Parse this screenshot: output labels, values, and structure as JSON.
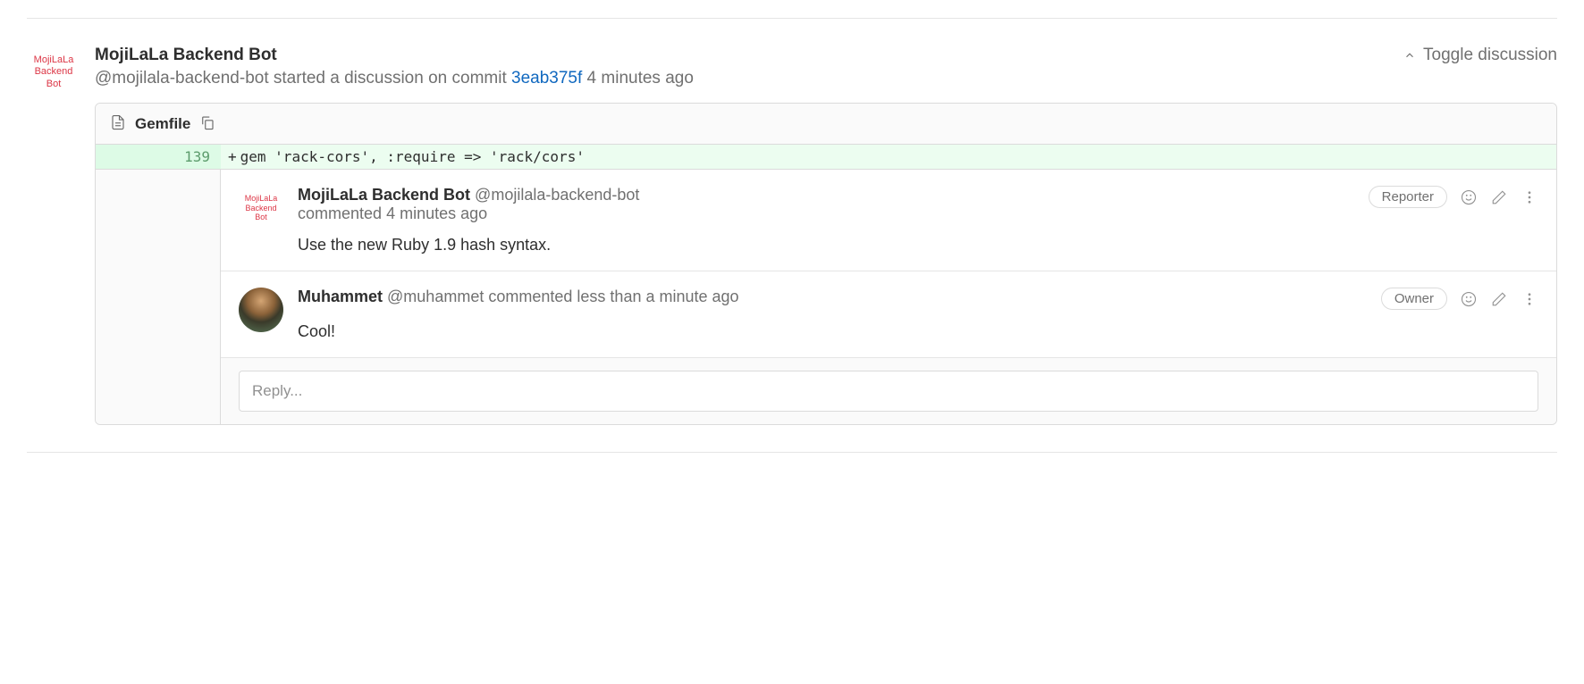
{
  "discussion": {
    "author_name": "MojiLaLa Backend Bot",
    "author_handle": "@mojilala-backend-bot",
    "action_text": "started a discussion on commit",
    "commit_sha": "3eab375f",
    "timestamp": "4 minutes ago",
    "avatar_text": "MojiLaLa\nBackend\nBot"
  },
  "toggle_label": "Toggle discussion",
  "file": {
    "name": "Gemfile"
  },
  "diff": {
    "line_number": "139",
    "prefix": "+",
    "code": "gem 'rack-cors', :require => 'rack/cors'"
  },
  "notes": [
    {
      "author_name": "MojiLaLa Backend Bot",
      "author_handle": "@mojilala-backend-bot",
      "action": "commented",
      "timestamp": "4 minutes ago",
      "role": "Reporter",
      "body": "Use the new Ruby 1.9 hash syntax.",
      "avatar_type": "text",
      "avatar_text": "MojiLaLa\nBackend\nBot"
    },
    {
      "author_name": "Muhammet",
      "author_handle": "@muhammet",
      "action": "commented",
      "timestamp": "less than a minute ago",
      "role": "Owner",
      "body": "Cool!",
      "avatar_type": "photo"
    }
  ],
  "reply": {
    "placeholder": "Reply..."
  }
}
